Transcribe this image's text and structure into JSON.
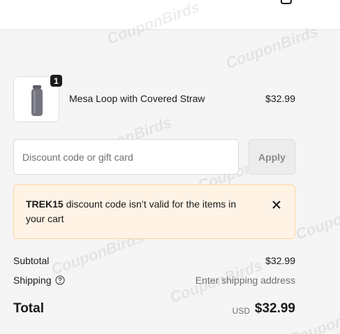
{
  "header": {
    "bag_icon": "shopping-bag-icon"
  },
  "watermark": {
    "text": "CouponBirds"
  },
  "product": {
    "name": "Mesa Loop with Covered Straw",
    "price": "$32.99",
    "quantity": "1",
    "image_icon": "water-bottle-icon"
  },
  "discount": {
    "placeholder": "Discount code or gift card",
    "value": "",
    "apply_label": "Apply"
  },
  "error": {
    "code": "TREK15",
    "message": " discount code isn’t valid for the items in your cart",
    "close_icon": "close-icon"
  },
  "summary": {
    "subtotal_label": "Subtotal",
    "subtotal_value": "$32.99",
    "shipping_label": "Shipping",
    "shipping_value": "Enter shipping address",
    "total_label": "Total",
    "currency": "USD",
    "total_value": "$32.99"
  }
}
